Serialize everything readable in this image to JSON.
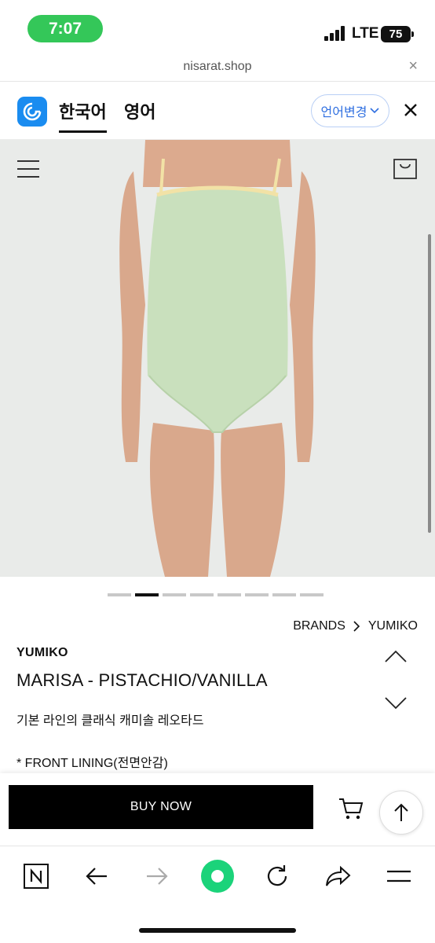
{
  "status_bar": {
    "time": "7:07",
    "network": "LTE",
    "battery": "75"
  },
  "url_bar": {
    "url": "nisarat.shop",
    "close_label": "×"
  },
  "translate_bar": {
    "lang_korean": "한국어",
    "lang_english": "영어",
    "change_language": "언어변경",
    "close_label": "✕"
  },
  "carousel": {
    "total": 8,
    "active_index": 1
  },
  "breadcrumb": {
    "brands": "BRANDS",
    "separator": ">",
    "current": "YUMIKO"
  },
  "product": {
    "brand": "YUMIKO",
    "name": "MARISA - PISTACHIO/VANILLA",
    "description": "기본 라인의 클래식 캐미솔 레오타드",
    "lining_note": "* FRONT LINING(전면안감)"
  },
  "buy_bar": {
    "buy_now_label": "BUY NOW"
  },
  "icons": {
    "menu": "menu-icon",
    "bag": "shopping-bag-icon",
    "cart": "cart-icon",
    "top": "arrow-up-icon",
    "naver": "naver-icon",
    "back": "arrow-left-icon",
    "forward": "arrow-right-icon",
    "green": "green-home-icon",
    "refresh": "refresh-icon",
    "share": "share-icon",
    "more": "hamburger-icon"
  },
  "colors": {
    "status_green": "#34c759",
    "accent_blue": "#2f6fe0",
    "garment_green": "#c9e0bd",
    "trim_vanilla": "#f2e2a6"
  }
}
